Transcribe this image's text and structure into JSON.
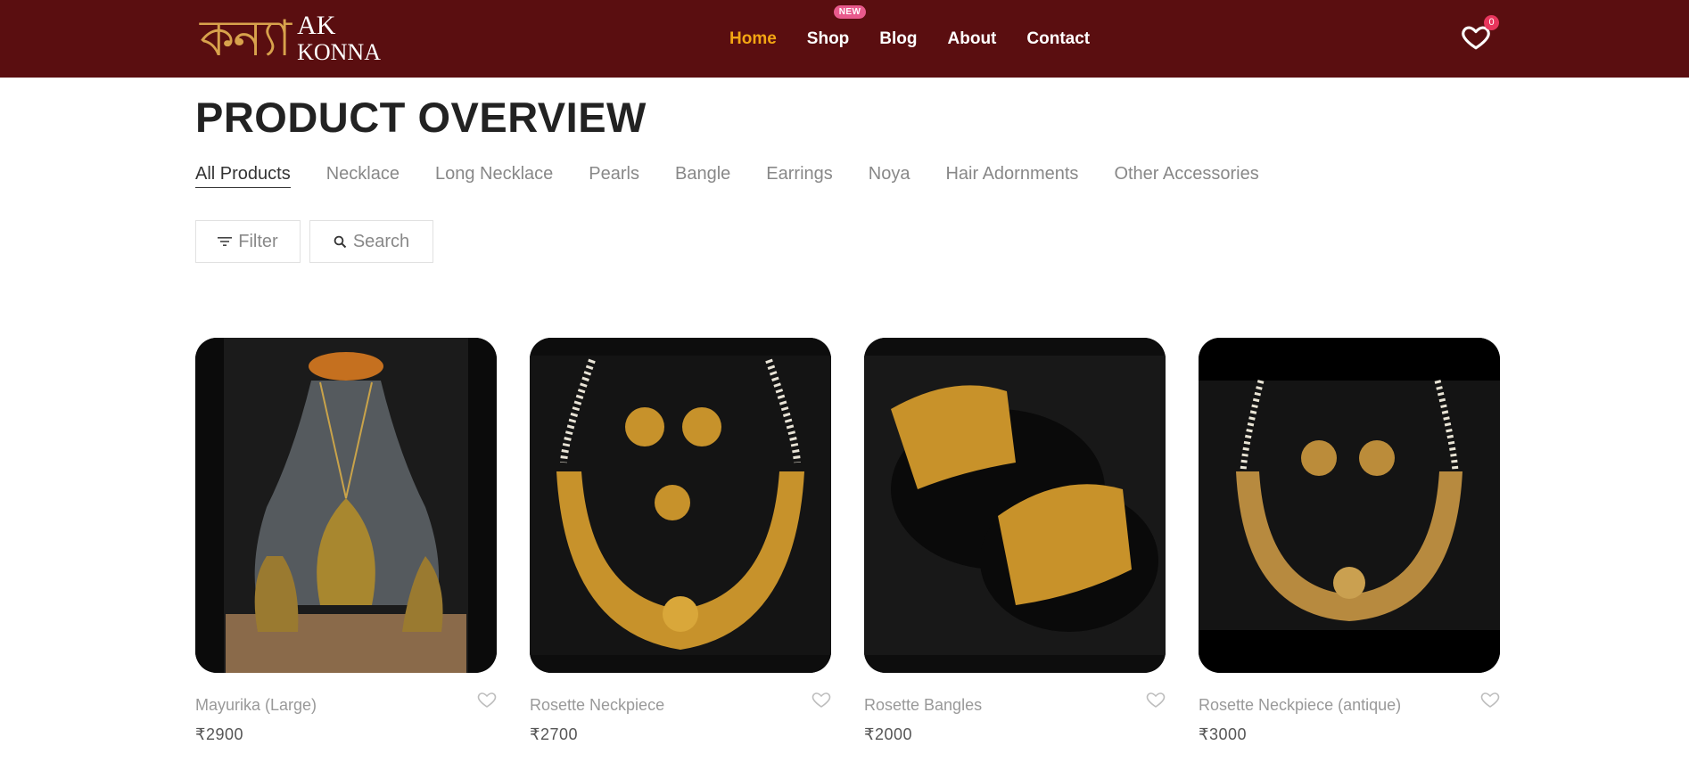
{
  "brand": {
    "script": "কন্যা",
    "line1": "AK",
    "line2": "KONNA"
  },
  "nav": {
    "items": [
      {
        "label": "Home",
        "active": true
      },
      {
        "label": "Shop",
        "badge": "NEW"
      },
      {
        "label": "Blog"
      },
      {
        "label": "About"
      },
      {
        "label": "Contact"
      }
    ]
  },
  "cart": {
    "count": "0",
    "icon": "heart-icon"
  },
  "page": {
    "title": "PRODUCT OVERVIEW"
  },
  "categories": [
    "All Products",
    "Necklace",
    "Long Necklace",
    "Pearls",
    "Bangle",
    "Earrings",
    "Noya",
    "Hair Adornments",
    "Other Accessories"
  ],
  "tools": {
    "filter_label": "Filter",
    "search_label": "Search"
  },
  "products": [
    {
      "name": "Mayurika (Large)",
      "price": "₹2900"
    },
    {
      "name": "Rosette Neckpiece",
      "price": "₹2700"
    },
    {
      "name": "Rosette Bangles",
      "price": "₹2000"
    },
    {
      "name": "Rosette Neckpiece (antique)",
      "price": "₹3000"
    }
  ],
  "colors": {
    "header": "#5a0e10",
    "accent": "#f3a613",
    "badge": "#e85a8c",
    "gold": "#c9962e"
  }
}
